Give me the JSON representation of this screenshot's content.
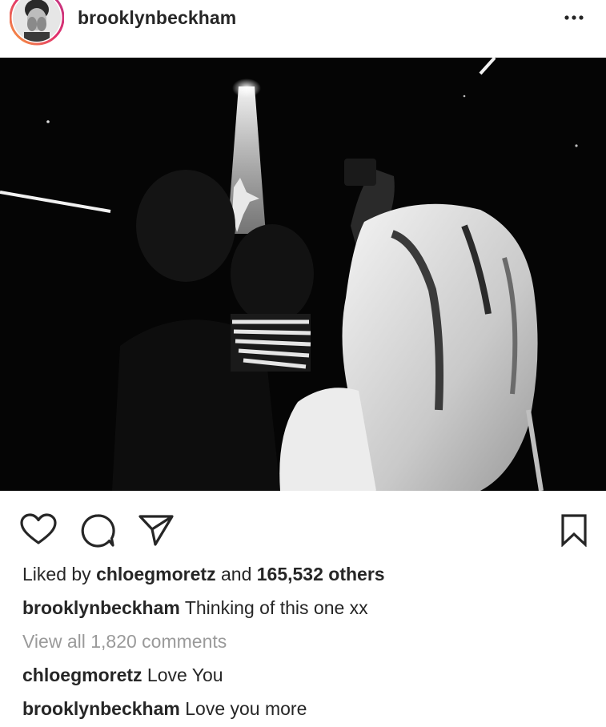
{
  "post": {
    "username": "brooklynbeckham",
    "more_icon": "more-horizontal-icon"
  },
  "actions": {
    "like_icon": "heart-icon",
    "comment_icon": "comment-icon",
    "share_icon": "paper-plane-icon",
    "save_icon": "bookmark-icon"
  },
  "likes": {
    "prefix": "Liked by ",
    "user": "chloegmoretz",
    "middle": " and ",
    "others": "165,532 others"
  },
  "caption": {
    "user": "brooklynbeckham",
    "text": "Thinking of this one xx"
  },
  "view_all_comments": "View all 1,820 comments",
  "comments": [
    {
      "user": "chloegmoretz",
      "text": "Love You"
    },
    {
      "user": "brooklynbeckham",
      "text": "Love you more"
    }
  ]
}
